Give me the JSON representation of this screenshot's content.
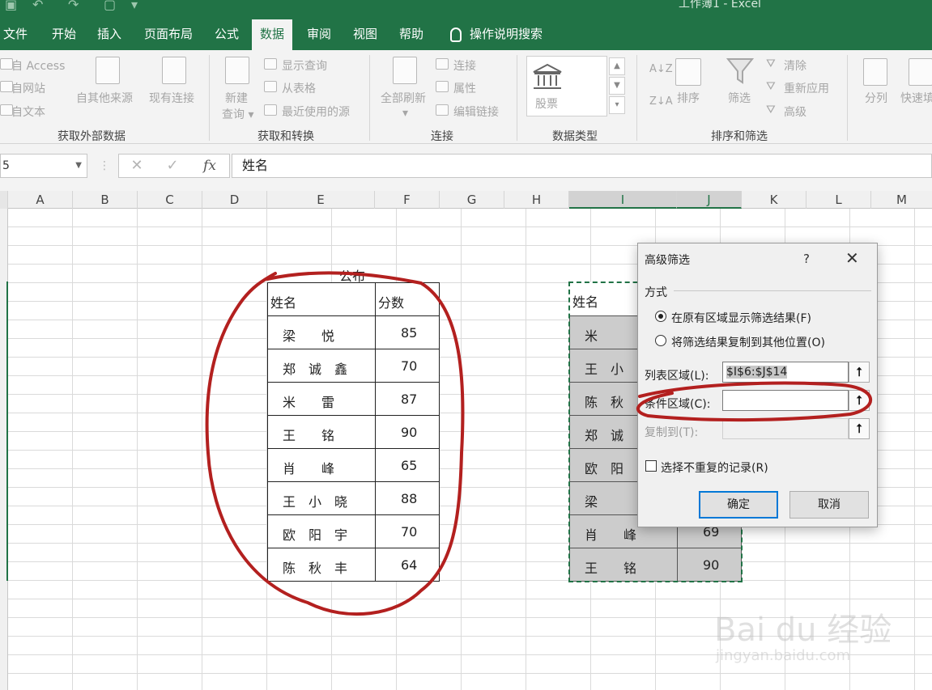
{
  "window": {
    "title": "工作簿1 - Excel"
  },
  "tabs": [
    {
      "label": "文件"
    },
    {
      "label": "开始"
    },
    {
      "label": "插入"
    },
    {
      "label": "页面布局"
    },
    {
      "label": "公式"
    },
    {
      "label": "数据"
    },
    {
      "label": "审阅"
    },
    {
      "label": "视图"
    },
    {
      "label": "帮助"
    },
    {
      "label": "操作说明搜索"
    }
  ],
  "ribbon": {
    "external": {
      "access": "自 Access",
      "web": "自网站",
      "text": "自文本",
      "other": "自其他来源",
      "existing": "现有连接",
      "group": "获取外部数据"
    },
    "transform": {
      "new_query_1": "新建",
      "new_query_2": "查询 ▾",
      "show_queries": "显示查询",
      "from_table": "从表格",
      "recent": "最近使用的源",
      "group": "获取和转换"
    },
    "connections": {
      "refresh_all": "全部刷新",
      "refresh_dd": "▾",
      "conn": "连接",
      "props": "属性",
      "edit_links": "编辑链接",
      "group": "连接"
    },
    "datatypes": {
      "stocks": "股票",
      "group": "数据类型"
    },
    "sortfilter": {
      "sort": "排序",
      "filter": "筛选",
      "clear": "清除",
      "reapply": "重新应用",
      "advanced": "高级",
      "group": "排序和筛选"
    },
    "tools": {
      "split": "分列",
      "flash": "快速填"
    }
  },
  "formula_bar": {
    "name_box": "5",
    "fx": "fx",
    "value": "姓名"
  },
  "columns": [
    "A",
    "B",
    "C",
    "D",
    "E",
    "F",
    "G",
    "H",
    "I",
    "J",
    "K",
    "L",
    "M"
  ],
  "left_table": {
    "caption": "公布",
    "headers": [
      "姓名",
      "分数"
    ],
    "rows": [
      {
        "name": "梁　　悦",
        "score": "85"
      },
      {
        "name": "郑　诚　鑫",
        "score": "70"
      },
      {
        "name": "米　　雷",
        "score": "87"
      },
      {
        "name": "王　　铭",
        "score": "90"
      },
      {
        "name": "肖　　峰",
        "score": "65"
      },
      {
        "name": "王　小　晓",
        "score": "88"
      },
      {
        "name": "欧　阳　宇",
        "score": "70"
      },
      {
        "name": "陈　秋　丰",
        "score": "64"
      }
    ]
  },
  "right_table": {
    "header": "姓名",
    "rows": [
      {
        "name": "米",
        "score": ""
      },
      {
        "name": "王　小",
        "score": ""
      },
      {
        "name": "陈　秋",
        "score": ""
      },
      {
        "name": "郑　诚",
        "score": ""
      },
      {
        "name": "欧　阳",
        "score": ""
      },
      {
        "name": "梁",
        "score": ""
      },
      {
        "name": "肖　　峰",
        "score": "69"
      },
      {
        "name": "王　　铭",
        "score": "90"
      }
    ]
  },
  "dialog": {
    "title": "高级筛选",
    "help": "?",
    "close": "✕",
    "section": "方式",
    "option1": "在原有区域显示筛选结果(F)",
    "option2": "将筛选结果复制到其他位置(O)",
    "list_range_label": "列表区域(L):",
    "list_range_value": "$I$6:$J$14",
    "criteria_label": "条件区域(C):",
    "criteria_value": "",
    "copy_to_label": "复制到(T):",
    "unique_label": "选择不重复的记录(R)",
    "ok": "确定",
    "cancel": "取消"
  },
  "watermark": {
    "brand": "Bai du 经验",
    "url": "jingyan.baidu.com"
  }
}
